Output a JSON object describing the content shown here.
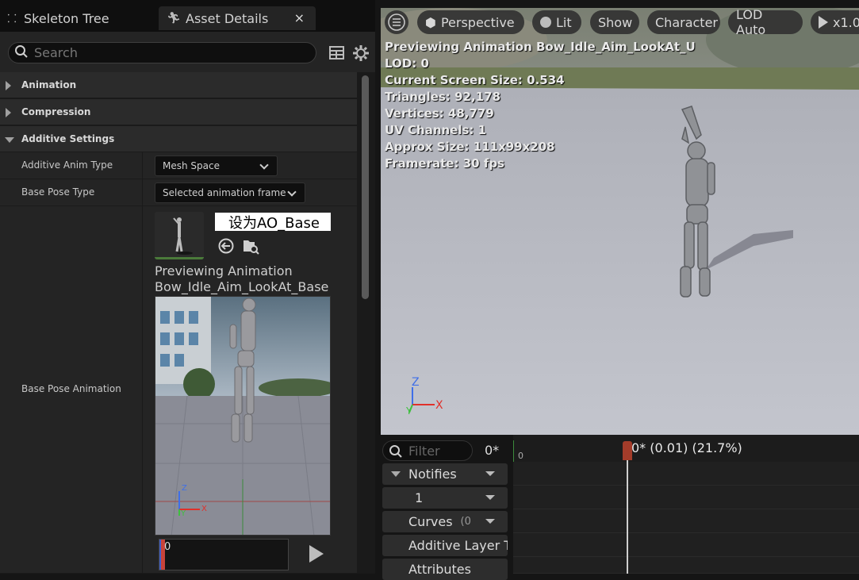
{
  "tabs": {
    "skeleton": "Skeleton Tree",
    "details": "Asset Details",
    "close": "×"
  },
  "search": {
    "placeholder": "Search"
  },
  "categories": {
    "animation": "Animation",
    "compression": "Compression",
    "additive": "Additive Settings"
  },
  "props": {
    "anim_type_label": "Additive Anim Type",
    "anim_type_value": "Mesh Space",
    "base_pose_label": "Base Pose Type",
    "base_pose_value": "Selected animation frame",
    "base_anim_label": "Base Pose Animation",
    "asset_name": "设为AO_Base",
    "preview_line1": "Previewing Animation",
    "preview_line2": "Bow_Idle_Aim_LookAt_Base",
    "scrub_value": "0"
  },
  "viewport": {
    "perspective": "Perspective",
    "lit": "Lit",
    "show": "Show",
    "character": "Character",
    "lod": "LOD Auto",
    "speed": "x1.0",
    "stats": [
      "Previewing Animation Bow_Idle_Aim_LookAt_U",
      "LOD: 0",
      "Current Screen Size: 0.534",
      "Triangles: 92,178",
      "Vertices: 48,779",
      "UV Channels: 1",
      "Approx Size: 111x99x208",
      "Framerate: 30 fps"
    ],
    "axis_z": "Z",
    "axis_x": "X",
    "axis_y": "Y"
  },
  "timeline": {
    "filter_placeholder": "Filter",
    "frame_count": "0*",
    "tracks": [
      "Notifies",
      "1",
      "Curves",
      "Additive Layer T",
      "Attributes"
    ],
    "curves_suffix": "(0",
    "start_tick": "0",
    "marker_label": "0* (0.01) (21.7%)"
  },
  "colors": {
    "accent_marker": "#a33c2a",
    "axis_x": "#e0302a",
    "axis_y": "#3fbf3f",
    "axis_z": "#3f6fe8"
  }
}
